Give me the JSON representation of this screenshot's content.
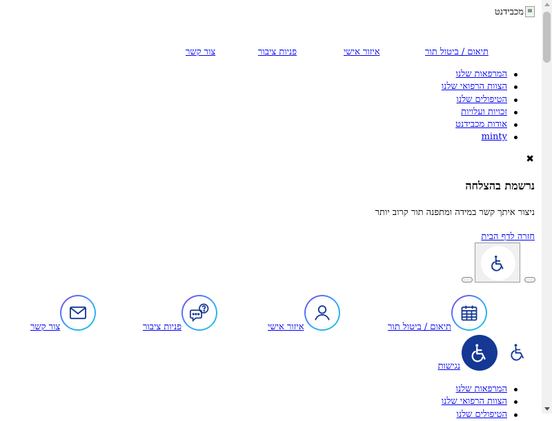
{
  "header": {
    "logo_alt": "מכבידנט"
  },
  "top_nav": {
    "items": [
      {
        "label": "תיאום / ביטול תור"
      },
      {
        "label": "איזור אישי"
      },
      {
        "label": "פניות ציבור"
      },
      {
        "label": "צור קשר"
      }
    ]
  },
  "main_menu": {
    "items": [
      {
        "label": "המרפאות שלנו"
      },
      {
        "label": "הצוות הרפואי שלנו"
      },
      {
        "label": "הטיפולים שלנו"
      },
      {
        "label": "זכויות ועלויות"
      },
      {
        "label": "אודות מכבידנט"
      },
      {
        "label": "minty"
      }
    ]
  },
  "modal": {
    "close_glyph": "✖",
    "title": "נרשמת בהצלחה",
    "message": "ניצור איתך קשר במידה ומתפנה תור קרוב יותר",
    "home_link": "חזרה לדף הבית"
  },
  "quick_links": {
    "items": [
      {
        "label": "תיאום / ביטול תור",
        "icon": "calendar-icon"
      },
      {
        "label": "איזור אישי",
        "icon": "user-icon"
      },
      {
        "label": "פניות ציבור",
        "icon": "chat-question-icon"
      },
      {
        "label": "צור קשר",
        "icon": "mail-icon"
      }
    ]
  },
  "accessibility": {
    "label": "נגישות",
    "icon": "wheelchair-icon",
    "button_color": "#143894"
  },
  "footer_menu": {
    "items": [
      {
        "label": "המרפאות שלנו"
      },
      {
        "label": "הצוות הרפואי שלנו"
      },
      {
        "label": "הטיפולים שלנו"
      }
    ]
  }
}
